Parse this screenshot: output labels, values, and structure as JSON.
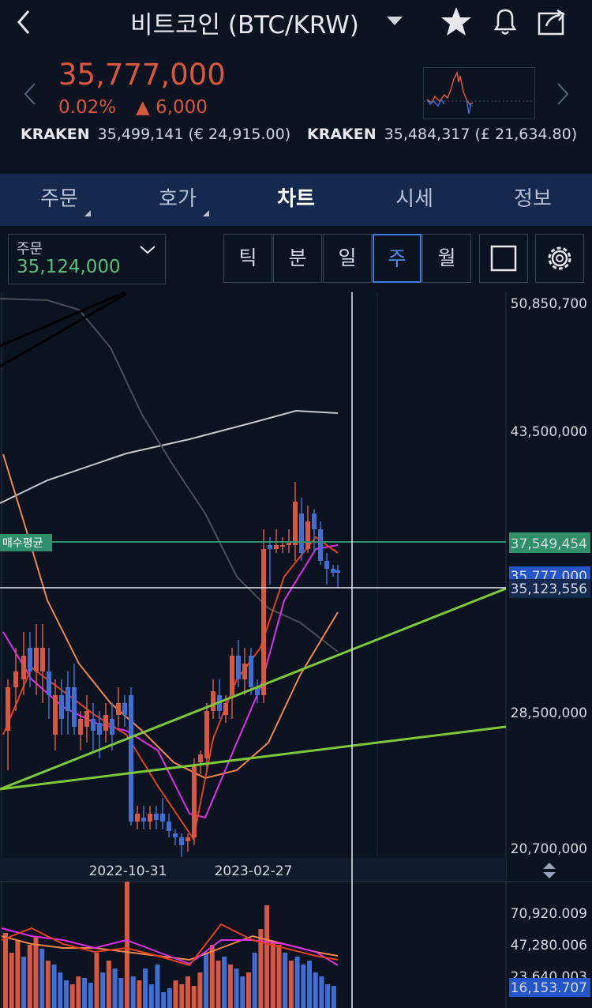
{
  "header": {
    "title": "비트코인 (BTC/KRW)",
    "back_icon": "back-chevron-icon",
    "icons": [
      "star-icon",
      "bell-icon",
      "share-icon"
    ]
  },
  "price": {
    "current": "35,777,000",
    "change_pct": "0.02%",
    "change_abs": "▲ 6,000",
    "color_up": "#d9573f"
  },
  "tickers": [
    {
      "exchange": "KRAKEN",
      "value": "35,499,141 (€ 24,915.00)"
    },
    {
      "exchange": "KRAKEN",
      "value": "35,484,317 (£ 21,634.80)"
    }
  ],
  "tabs": [
    {
      "label": "주문",
      "has_sub": true
    },
    {
      "label": "호가",
      "has_sub": true
    },
    {
      "label": "차트",
      "has_sub": false,
      "active": true
    },
    {
      "label": "시세",
      "has_sub": false
    },
    {
      "label": "정보",
      "has_sub": false
    }
  ],
  "order_box": {
    "label": "주문",
    "value": "35,124,000"
  },
  "periods": [
    {
      "label": "틱"
    },
    {
      "label": "분"
    },
    {
      "label": "일"
    },
    {
      "label": "주",
      "active": true
    },
    {
      "label": "월"
    }
  ],
  "chart_data": {
    "type": "candlestick",
    "y_axis_labels": [
      "50,850,700",
      "43,500,000",
      "28,500,000",
      "20,700,000"
    ],
    "ylim": [
      20700000,
      50850700
    ],
    "x_axis_labels": [
      "2022-10-31",
      "2023-02-27"
    ],
    "avg_buy_label": "매수평균",
    "avg_buy_price": "37,549,454",
    "current_price_tag": "35,777,000",
    "crosshair_price": "35,123,556",
    "volume_labels": [
      "70,920.009",
      "47,280.006",
      "23,640.003"
    ],
    "volume_tag": "16,153.707",
    "colors": {
      "up": "#d9573f",
      "down": "#3f6fd3",
      "avg_line": "#2f8f6a",
      "trend": "#7cc83a",
      "tag": "#2355c9"
    }
  }
}
